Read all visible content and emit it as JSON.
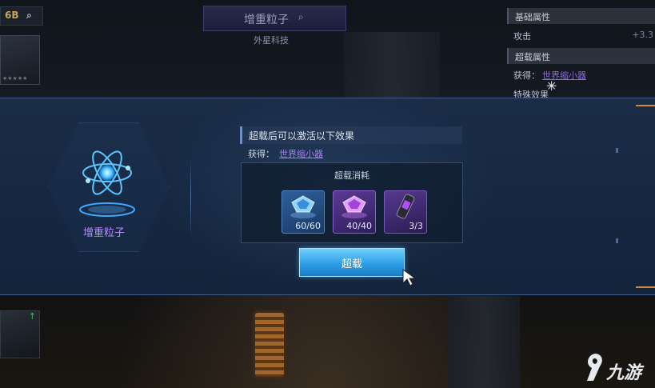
{
  "background": {
    "top_left_badge": "6B",
    "title": "增重粒子",
    "subtitle": "外星科技",
    "right_panel": {
      "base_attr_header": "基础属性",
      "attack_label": "攻击",
      "attack_value": "+3.3",
      "super_attr_header": "超载属性",
      "obtain_label": "获得：",
      "obtain_link": "世界缩小器",
      "special_label": "特殊效果"
    },
    "thumb_stars": "★★★★★"
  },
  "dialog": {
    "item_name": "增重粒子",
    "effect_header": "超载后可以激活以下效果",
    "obtain_label": "获得：",
    "obtain_link": "世界缩小器",
    "cost_title": "超载消耗",
    "materials": [
      {
        "icon": "blue-crystal-icon",
        "qty": "60/60"
      },
      {
        "icon": "purple-crystal-icon",
        "qty": "40/40"
      },
      {
        "icon": "canister-icon",
        "qty": "3/3"
      }
    ],
    "overload_button": "超载"
  },
  "watermark": "九游",
  "colors": {
    "accent_purple": "#b88cff",
    "button_blue": "#2e9ee6",
    "link_purple": "#a77cf7",
    "edge_orange": "#d8863a"
  }
}
